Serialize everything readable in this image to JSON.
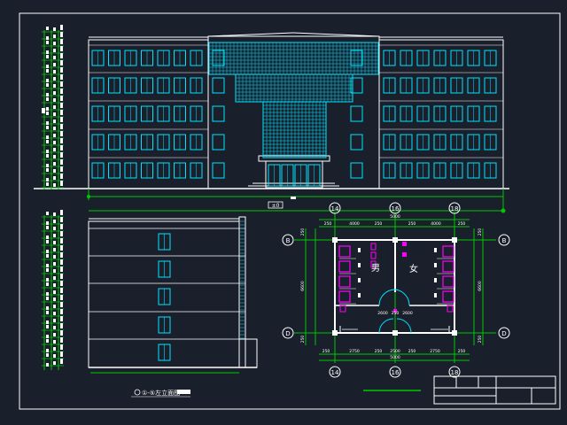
{
  "colors": {
    "background": "#1a1f2c",
    "frame": "#ffffff",
    "building": "#ffffff",
    "windows": "#00e5ff",
    "dimension": "#00c800",
    "axis_circle": "#ffffff",
    "fixture": "#ff00ff",
    "axis_label_color": "#ffffff",
    "dim_text": "#ffffff",
    "annotation": "#ffff00"
  },
  "front_elevation": {
    "floors": 5,
    "ground_mark": "±0"
  },
  "side_elevation": {
    "title": "①-⑤左立面图"
  },
  "plan": {
    "axes_x": [
      "14",
      "16",
      "18"
    ],
    "axes_y": [
      "B",
      "D"
    ],
    "room_male": "男",
    "room_female": "女",
    "dims_top_total": "5000",
    "dims_top": [
      "250",
      "4000",
      "250",
      "250",
      "4000",
      "250"
    ],
    "dims_bottom_total": "5000",
    "dims_bottom": [
      "250",
      "2750",
      "250",
      "2500",
      "250",
      "2750",
      "250"
    ],
    "dims_inner": [
      "2600",
      "250",
      "2600"
    ],
    "dims_left": [
      "250",
      "6600",
      "250"
    ],
    "dims_right": [
      "250",
      "6600",
      "250"
    ]
  }
}
